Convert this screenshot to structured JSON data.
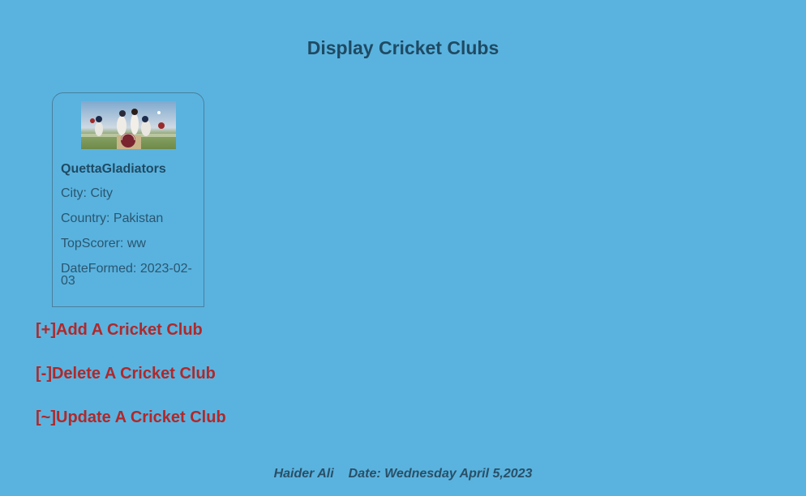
{
  "page": {
    "title": "Display Cricket Clubs"
  },
  "clubs": [
    {
      "name": "QuettaGladiators",
      "city": "City: City",
      "country": "Country: Pakistan",
      "top_scorer": "TopScorer: ww",
      "date_formed": "DateFormed: 2023-02-03"
    }
  ],
  "actions": {
    "add": "[+]Add A Cricket Club",
    "delete": "[-]Delete A Cricket Club",
    "update": "[~]Update A Cricket Club"
  },
  "footer": {
    "author": "Haider Ali",
    "date": "Date: Wednesday April 5,2023"
  },
  "colors": {
    "background": "#5ab3df",
    "heading": "#1f4a63",
    "link": "#b0282a",
    "card_border": "#4a7f9c"
  }
}
